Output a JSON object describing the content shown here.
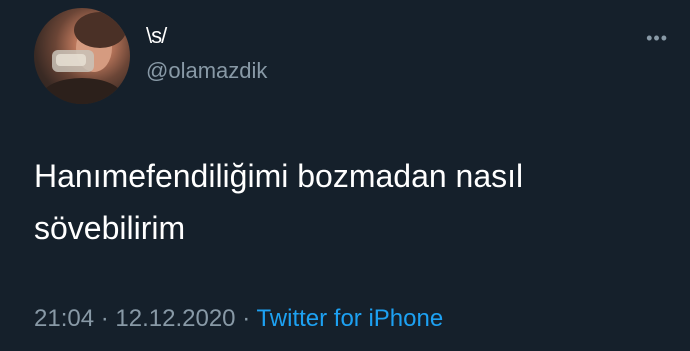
{
  "tweet": {
    "display_name": "\\s/",
    "handle": "@olamazdik",
    "text_line1": "Hanımefendiliğimi bozmadan nasıl",
    "text_line2": "sövebilirim",
    "time": "21:04",
    "separator": "·",
    "date": "12.12.2020",
    "source": "Twitter for iPhone",
    "more_icon": "more-horizontal-icon",
    "avatar_icon": "profile-photo"
  },
  "colors": {
    "background": "#15202b",
    "primary_text": "#ffffff",
    "secondary_text": "#8899a6",
    "link": "#1da1f2"
  }
}
